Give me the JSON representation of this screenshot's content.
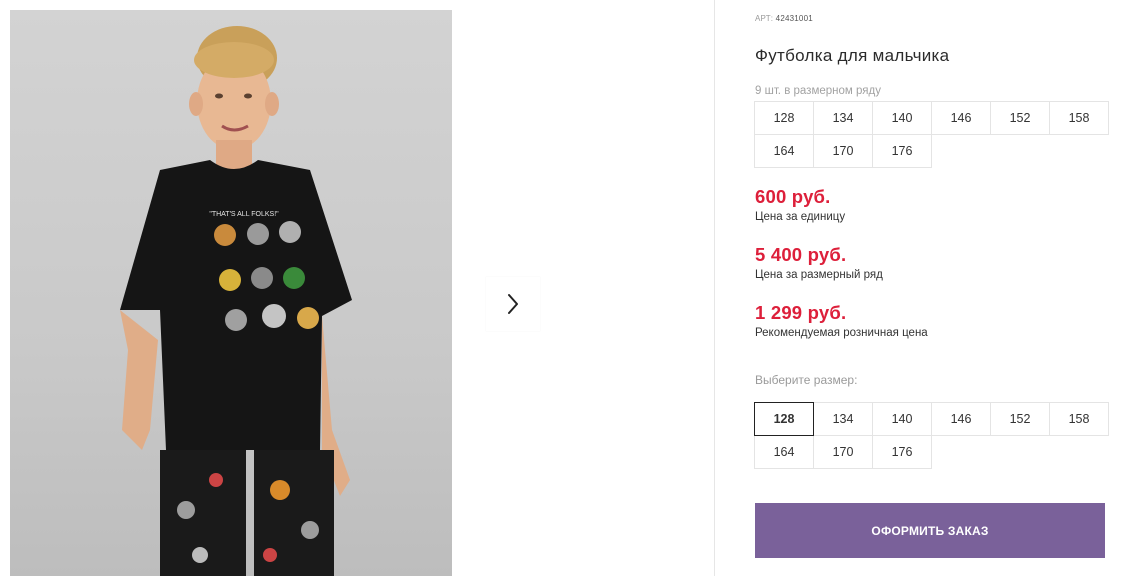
{
  "gallery": {
    "next_icon": "chevron-right-icon"
  },
  "product": {
    "sku_label": "АРТ:",
    "sku_value": "42431001",
    "title": "Футболка для мальчика",
    "size_row_count": "9 шт. в размерном ряду",
    "size_row": [
      "128",
      "134",
      "140",
      "146",
      "152",
      "158",
      "164",
      "170",
      "176"
    ]
  },
  "prices": {
    "unit_price": "600 руб.",
    "unit_label": "Цена за единицу",
    "row_price": "5 400 руб.",
    "row_label": "Цена за размерный ряд",
    "retail_price": "1 299 руб.",
    "retail_label": "Рекомендуемая розничная цена"
  },
  "size_select": {
    "label": "Выберите размер:",
    "sizes": [
      "128",
      "134",
      "140",
      "146",
      "152",
      "158",
      "164",
      "170",
      "176"
    ],
    "selected": "128"
  },
  "order": {
    "button_label": "ОФОРМИТЬ ЗАКАЗ",
    "color": "#7a619a"
  },
  "colors": {
    "price": "#dd1f3a",
    "accent": "#7a619a"
  }
}
